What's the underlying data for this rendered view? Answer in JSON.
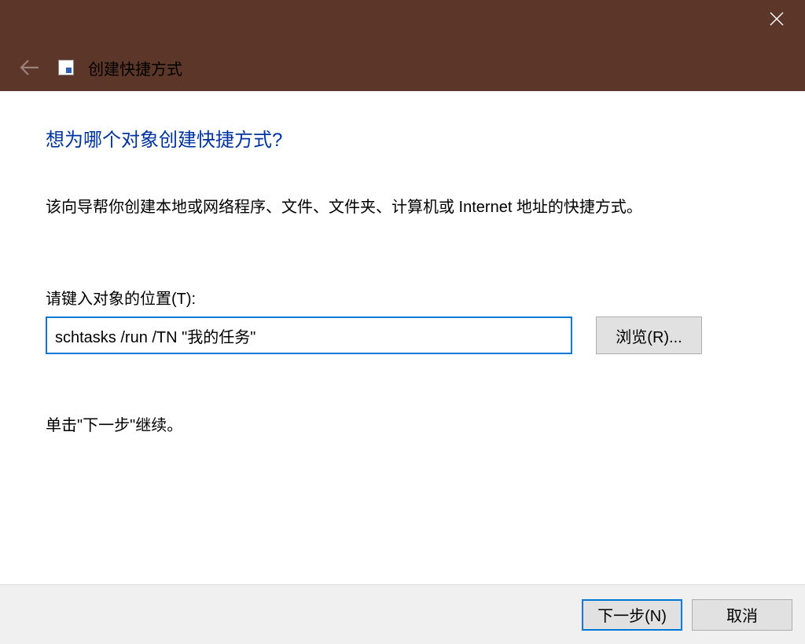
{
  "titlebar": {
    "window_title": "创建快捷方式"
  },
  "content": {
    "heading": "想为哪个对象创建快捷方式?",
    "description": "该向导帮你创建本地或网络程序、文件、文件夹、计算机或 Internet 地址的快捷方式。",
    "field_label": "请键入对象的位置(T):",
    "location_value": "schtasks /run /TN \"我的任务\"",
    "browse_label": "浏览(R)...",
    "continue_text": "单击\"下一步\"继续。"
  },
  "footer": {
    "next_label": "下一步(N)",
    "cancel_label": "取消"
  }
}
